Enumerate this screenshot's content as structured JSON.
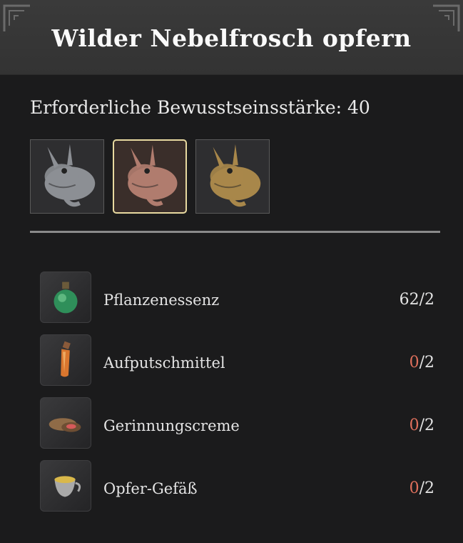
{
  "dialog": {
    "title": "Wilder Nebelfrosch opfern",
    "requirement_label": "Erforderliche Bewusstseinsstärke: 40"
  },
  "variants": [
    {
      "name": "Grauer Frosch",
      "color": "#8c8f94",
      "selected": false
    },
    {
      "name": "Roter Frosch",
      "color": "#b07c6e",
      "selected": true
    },
    {
      "name": "Goldener Frosch",
      "color": "#a8874a",
      "selected": false
    }
  ],
  "materials": [
    {
      "name": "Pflanzenessenz",
      "have": "62",
      "need": "2",
      "icon": "green-potion-icon"
    },
    {
      "name": "Aufputschmittel",
      "have": "0",
      "need": "2",
      "icon": "orange-vial-icon"
    },
    {
      "name": "Gerinnungscreme",
      "have": "0",
      "need": "2",
      "icon": "cream-tin-icon"
    },
    {
      "name": "Opfer-Gefäß",
      "have": "0",
      "need": "2",
      "icon": "golden-cup-icon"
    }
  ],
  "colors": {
    "insufficient": "#e0705c",
    "selected_border": "#e8d9a0"
  }
}
